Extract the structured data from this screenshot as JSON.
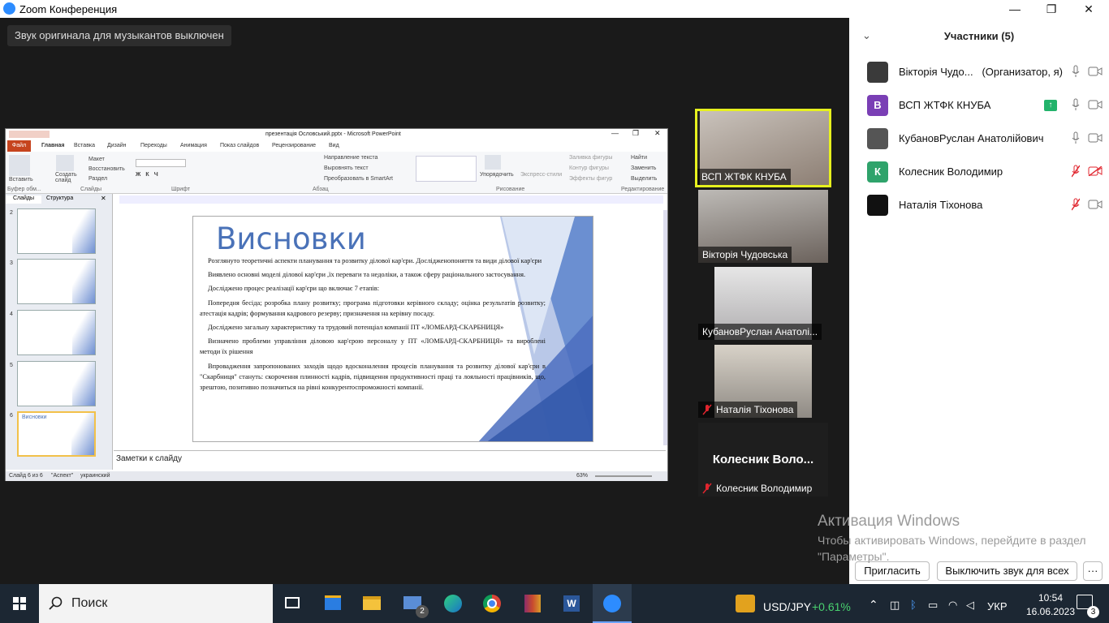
{
  "window": {
    "title": "Zoom Конференция",
    "minimize": "—",
    "restore": "❐",
    "close": "✕"
  },
  "notification": {
    "text": "Звук оригинала для музыкантов выключен"
  },
  "ppt": {
    "title": "презентація Ословський.pptx - Microsoft PowerPoint",
    "file_tab": "Файл",
    "tabs": [
      "Главная",
      "Вставка",
      "Дизайн",
      "Переходы",
      "Анимация",
      "Показ слайдов",
      "Рецензирование",
      "Вид"
    ],
    "groups": [
      "Буфер обм...",
      "Слайды",
      "Шрифт",
      "Абзац",
      "Рисование",
      "Редактирование"
    ],
    "ribbon_items": [
      "Вставить",
      "Создать слайд",
      "Макет",
      "Восстановить",
      "Раздел",
      "Направление текста",
      "Выровнять текст",
      "Преобразовать в SmartArt",
      "Упорядочить",
      "Экспресс-стили",
      "Заливка фигуры",
      "Контур фигуры",
      "Эффекты фигур",
      "Найти",
      "Заменить",
      "Выделить"
    ],
    "panel_tabs": [
      "Слайды",
      "Структура"
    ],
    "thumb_numbers": [
      "2",
      "3",
      "4",
      "5",
      "6"
    ],
    "slide": {
      "title": "Висновки",
      "paragraphs": [
        "Розглянуто теоретичні аспекти планування та розвитку ділової кар'єри. Дослідженопоняття та види ділової кар'єри",
        "Виявлено основні моделі ділової кар'єри ,їх переваги та недоліки, а також сферу раціонального застосування.",
        "Досліджено процес реалізації кар'єри що включає 7 етапів:",
        "Попередня бесіда; розробка плану розвитку; програма підготовки керівного складу; оцінка результатів розвитку; атестація кадрів; формування кадрового резерву; призначення на керівну посаду.",
        "Досліджено загальну характеристику та трудовий потенціал компанії ПТ «ЛОМБАРД-СКАРБНИЦЯ»",
        "Визначено проблеми управління діловою кар'єрою персоналу у ПТ «ЛОМБАРД-СКАРБНИЦЯ» та вироблені методи їх рішення",
        "Впровадження запропонованих заходів щодо вдосконалення процесів планування та розвитку ділової кар'єри в \"Скарбниця\" стануть: скорочення плинності кадрів, підвищення продуктивності праці та лояльності працівників, що, зрештою, позитивно позначиться на рівні конкурентоспроможності компанії."
      ]
    },
    "notes_placeholder": "Заметки к слайду",
    "status": {
      "slide": "Слайд 6 из 6",
      "theme": "\"Аспект\"",
      "lang": "украинский",
      "zoom": "63%"
    }
  },
  "videos": [
    {
      "name": "ВСП ЖТФК КНУБА",
      "active": true,
      "muted": false
    },
    {
      "name": "Вікторія Чудовська",
      "muted": false
    },
    {
      "name": "КубановРуслан Анатолі...",
      "muted": false
    },
    {
      "name": "Наталія Тіхонова",
      "muted": true
    },
    {
      "name": "Колесник Володимир",
      "muted": true,
      "big_name": "Колесник Воло..."
    }
  ],
  "participants": {
    "header": "Участники (5)",
    "list": [
      {
        "name": "Вікторія Чудо...",
        "role": "(Организатор, я)",
        "avatar": "photo",
        "color": "#3a3a3a",
        "mic": "on",
        "cam": "on"
      },
      {
        "name": "ВСП ЖТФК КНУБА",
        "avatar": "В",
        "color": "#7a3fb5",
        "mic": "on",
        "cam": "on",
        "share": true
      },
      {
        "name": "КубановРуслан Анатолійович",
        "avatar": "photo",
        "color": "#555555",
        "mic": "on",
        "cam": "on"
      },
      {
        "name": "Колесник Володимир",
        "avatar": "К",
        "color": "#2fa36b",
        "mic": "off",
        "cam": "off"
      },
      {
        "name": "Наталія Тіхонова",
        "avatar": "photo",
        "color": "#111111",
        "mic": "off",
        "cam": "on"
      }
    ],
    "invite_button": "Пригласить",
    "mute_all_button": "Выключить звук для всех",
    "more_button": "···"
  },
  "watermark": {
    "title": "Активация Windows",
    "subtitle": "Чтобы активировать Windows, перейдите в раздел \"Параметры\"."
  },
  "taskbar": {
    "search_placeholder": "Поиск",
    "ticker": "USD/JPY",
    "ticker_change": "+0.61%",
    "lang": "УКР",
    "time": "10:54",
    "date": "16.06.2023",
    "notifications": "3",
    "mail_badge": "2"
  },
  "colors": {
    "accent": "#2d8cff",
    "muted": "#e0252e",
    "active_border": "#e6f01e",
    "slide_title": "#4a72b8"
  }
}
